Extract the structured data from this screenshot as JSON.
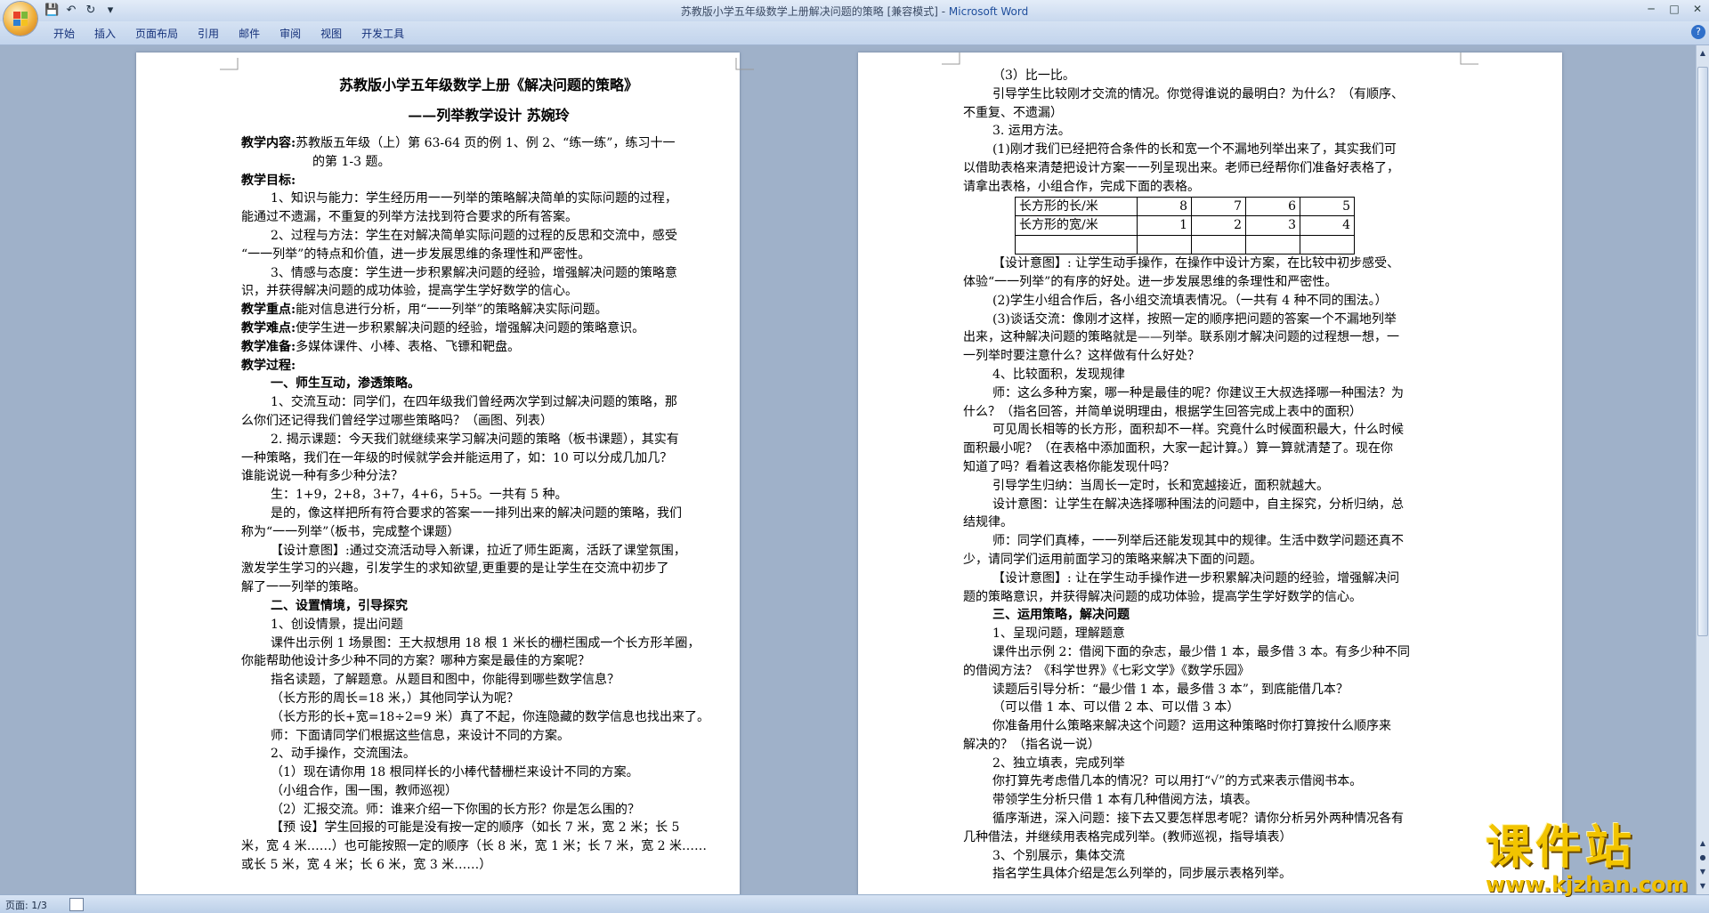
{
  "window": {
    "title": "苏教版小学五年级数学上册解决问题的策略 [兼容模式] - ",
    "app_name": "Microsoft Word"
  },
  "ribbon": {
    "tabs": [
      "开始",
      "插入",
      "页面布局",
      "引用",
      "邮件",
      "审阅",
      "视图",
      "开发工具"
    ]
  },
  "status": {
    "page": "页面: 1/3"
  },
  "watermark": {
    "main": "课件站",
    "url": "www.kjzhan.com"
  },
  "page1": {
    "title": "苏教版小学五年级数学上册《解决问题的策略》",
    "subtitle": "——列举教学设计          苏婉玲",
    "content_label": "教学内容:",
    "content_text": "苏教版五年级（上）第 63-64 页的例 1、例 2、“练一练”，练习十一",
    "content_text2": "的第 1-3 题。",
    "goals_label": "教学目标:",
    "p1": [
      "1、知识与能力：学生经历用一一列举的策略解决简单的实际问题的过程，",
      "能通过不遗漏，不重复的列举方法找到符合要求的所有答案。"
    ],
    "p2": [
      "2、过程与方法：学生在对解决简单实际问题的过程的反思和交流中，感受",
      "“一一列举”的特点和价值，进一步发展思维的条理性和严密性。"
    ],
    "p3": [
      "3、情感与态度：学生进一步积累解决问题的经验，增强解决问题的策略意",
      "识，并获得解决问题的成功体验，提高学生学好数学的信心。"
    ],
    "key_label": "教学重点:",
    "key_text": "能对信息进行分析，用“一一列举”的策略解决实际问题。",
    "diff_label": "教学难点:",
    "diff_text": "使学生进一步积累解决问题的经验，增强解决问题的策略意识。",
    "prep_label": "教学准备:",
    "prep_text": "多媒体课件、小棒、表格、飞镖和靶盘。",
    "process_label": "教学过程:",
    "s1": "一、师生互动，渗透策略。",
    "s1p1": [
      "1、交流互动：同学们，在四年级我们曾经两次学到过解决问题的策略，那",
      "么你们还记得我们曾经学过哪些策略吗？（画图、列表）"
    ],
    "s1p2": [
      "2. 揭示课题：今天我们就继续来学习解决问题的策略（板书课题），其实有",
      "一种策略，我们在一年级的时候就学会并能运用了，如：10 可以分成几加几？",
      "谁能说说一种有多少种分法？"
    ],
    "s1p3": "生：1+9，2+8，3+7，4+6，5+5。一共有 5 种。",
    "s1p4": [
      "是的，像这样把所有符合要求的答案一一排列出来的解决问题的策略，我们",
      "称为“一一列举”（板书，完成整个课题）"
    ],
    "s1p5": [
      "【设计意图】:通过交流活动导入新课，拉近了师生距离，活跃了课堂氛围，",
      "激发学生学习的兴趣，引发学生的求知欲望,更重要的是让学生在交流中初步了",
      "解了一一列举的策略。"
    ],
    "s2": "二、设置情境，引导探究",
    "s2p1": "1、创设情景，提出问题",
    "s2p2": [
      "课件出示例 1 场景图：王大叔想用 18 根 1 米长的栅栏围成一个长方形羊圈，",
      "你能帮助他设计多少种不同的方案？哪种方案是最佳的方案呢？"
    ],
    "s2p3": "指名读题，了解题意。从题目和图中，你能得到哪些数学信息？",
    "s2p4": "（长方形的周长=18 米，）其他同学认为呢？",
    "s2p5": "（长方形的长+宽=18÷2=9 米）真了不起，你连隐藏的数学信息也找出来了。",
    "s2p6": "师：下面请同学们根据这些信息，来设计不同的方案。",
    "s2p7": "2、动手操作，交流围法。",
    "s2p8": "（1）现在请你用 18 根同样长的小棒代替栅栏来设计不同的方案。",
    "s2p9": "（小组合作，围一围，教师巡视）",
    "s2p10": "（2）汇报交流。师：谁来介绍一下你围的长方形？你是怎么围的？",
    "s2p11": [
      "【预  设】学生回报的可能是没有按一定的顺序（如长 7 米，宽 2 米；长 5",
      "米，宽 4 米……）也可能按照一定的顺序（长 8 米，宽 1 米；长 7 米，宽 2 米……",
      "或长 5 米，宽 4 米；长 6 米，宽 3 米……）"
    ]
  },
  "page2": {
    "q1": "（3）比一比。",
    "q2": [
      "引导学生比较刚才交流的情况。你觉得谁说的最明白？为什么？（有顺序、",
      "不重复、不遗漏）"
    ],
    "q3": "3. 运用方法。",
    "q4": [
      "(1)刚才我们已经把符合条件的长和宽一个不漏地列举出来了，其实我们可",
      "以借助表格来清楚把设计方案一一列呈现出来。老师已经帮你们准备好表格了，",
      "请拿出表格，小组合作，完成下面的表格。"
    ],
    "table": {
      "rows": [
        {
          "label": "长方形的长/米",
          "values": [
            "8",
            "7",
            "6",
            "5"
          ]
        },
        {
          "label": "长方形的宽/米",
          "values": [
            "1",
            "2",
            "3",
            "4"
          ]
        },
        {
          "label": "",
          "values": [
            "",
            "",
            "",
            ""
          ]
        }
      ]
    },
    "q5": [
      "【设计意图】: 让学生动手操作，在操作中设计方案，在比较中初步感受、",
      "体验“一一列举”的有序的好处。进一步发展思维的条理性和严密性。"
    ],
    "q6": "(2)学生小组合作后，各小组交流填表情况。（一共有 4 种不同的围法。）",
    "q7": [
      "(3)谈话交流：像刚才这样，按照一定的顺序把问题的答案一个不漏地列举",
      "出来，这种解决问题的策略就是——列举。联系刚才解决问题的过程想一想，一",
      "一列举时要注意什么？这样做有什么好处？"
    ],
    "q8": "4、比较面积，发现规律",
    "q9": [
      "师：这么多种方案，哪一种是最佳的呢？你建议王大叔选择哪一种围法？为",
      "什么？（指名回答，并简单说明理由，根据学生回答完成上表中的面积）"
    ],
    "q10": [
      "可见周长相等的长方形，面积却不一样。究竟什么时候面积最大，什么时候",
      "面积最小呢？（在表格中添加面积，大家一起计算。）算一算就清楚了。现在你",
      "知道了吗？看着这表格你能发现什吗？"
    ],
    "q11": "引导学生归纳：当周长一定时，长和宽越接近，面积就越大。",
    "q12": [
      "设计意图：让学生在解决选择哪种围法的问题中，自主探究，分析归纳，总",
      "结规律。"
    ],
    "q13": [
      "师：同学们真棒，一一列举后还能发现其中的规律。生活中数学问题还真不",
      "少，请同学们运用前面学习的策略来解决下面的问题。"
    ],
    "q14": [
      "【设计意图】: 让在学生动手操作进一步积累解决问题的经验，增强解决问",
      "题的策略意识，并获得解决问题的成功体验，提高学生学好数学的信心。"
    ],
    "s3": "三、运用策略，解决问题",
    "r1": "1、呈现问题，理解题意",
    "r2": [
      "课件出示例 2：借阅下面的杂志，最少借 1 本，最多借 3 本。有多少种不同",
      "的借阅方法？《科学世界》《七彩文学》《数学乐园》"
    ],
    "r3": "读题后引导分析：“最少借 1 本，最多借 3 本”，到底能借几本？",
    "r4": "（可以借 1 本、可以借 2 本、可以借 3 本）",
    "r5": [
      "你准备用什么策略来解决这个问题？运用这种策略时你打算按什么顺序来",
      "解决的？（指名说一说）"
    ],
    "r6": "2、独立填表，完成列举",
    "r7": "你打算先考虑借几本的情况？可以用打“√”的方式来表示借阅书本。",
    "r8": "带领学生分析只借 1 本有几种借阅方法，填表。",
    "r9": [
      "循序渐进，深入问题：接下去又要怎样思考呢？请你分析另外两种情况各有",
      "几种借法，并继续用表格完成列举。(教师巡视，指导填表）"
    ],
    "r10": "3、个别展示，集体交流",
    "r11": "指名学生具体介绍是怎么列举的，同步展示表格列举。"
  }
}
